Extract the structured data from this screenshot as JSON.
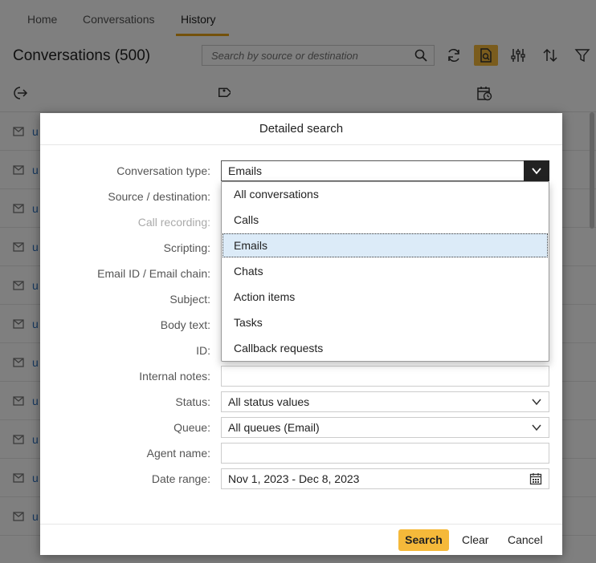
{
  "tabs": [
    {
      "label": "Home"
    },
    {
      "label": "Conversations"
    },
    {
      "label": "History"
    }
  ],
  "header": {
    "title": "Conversations (500)",
    "search_placeholder": "Search by source or destination"
  },
  "rows": [
    {
      "text": "u"
    },
    {
      "text": "u"
    },
    {
      "text": "u"
    },
    {
      "text": "u"
    },
    {
      "text": "u"
    },
    {
      "text": "u"
    },
    {
      "text": "u"
    },
    {
      "text": "u"
    },
    {
      "text": "u"
    },
    {
      "text": "u"
    },
    {
      "text": "u"
    }
  ],
  "modal": {
    "title": "Detailed search",
    "labels": {
      "conversation_type": "Conversation type:",
      "source_destination": "Source / destination:",
      "call_recording": "Call recording:",
      "scripting": "Scripting:",
      "email_id": "Email ID / Email chain:",
      "subject": "Subject:",
      "body_text": "Body text:",
      "id": "ID:",
      "internal_notes": "Internal notes:",
      "status": "Status:",
      "queue": "Queue:",
      "agent_name": "Agent name:",
      "date_range": "Date range:"
    },
    "values": {
      "conversation_type": "Emails",
      "internal_notes": "",
      "status": "All status values",
      "queue": "All queues (Email)",
      "agent_name": "",
      "date_range": "Nov 1, 2023 - Dec 8, 2023"
    },
    "dropdown_options": [
      "All conversations",
      "Calls",
      "Emails",
      "Chats",
      "Action items",
      "Tasks",
      "Callback requests"
    ],
    "selected_option": "Emails",
    "buttons": {
      "search": "Search",
      "clear": "Clear",
      "cancel": "Cancel"
    }
  },
  "colors": {
    "accent": "#f5b93a",
    "tab_underline": "#e8a317",
    "selected_option_bg": "#dcebf8",
    "overlay": "rgba(0,0,0,0.5)"
  }
}
